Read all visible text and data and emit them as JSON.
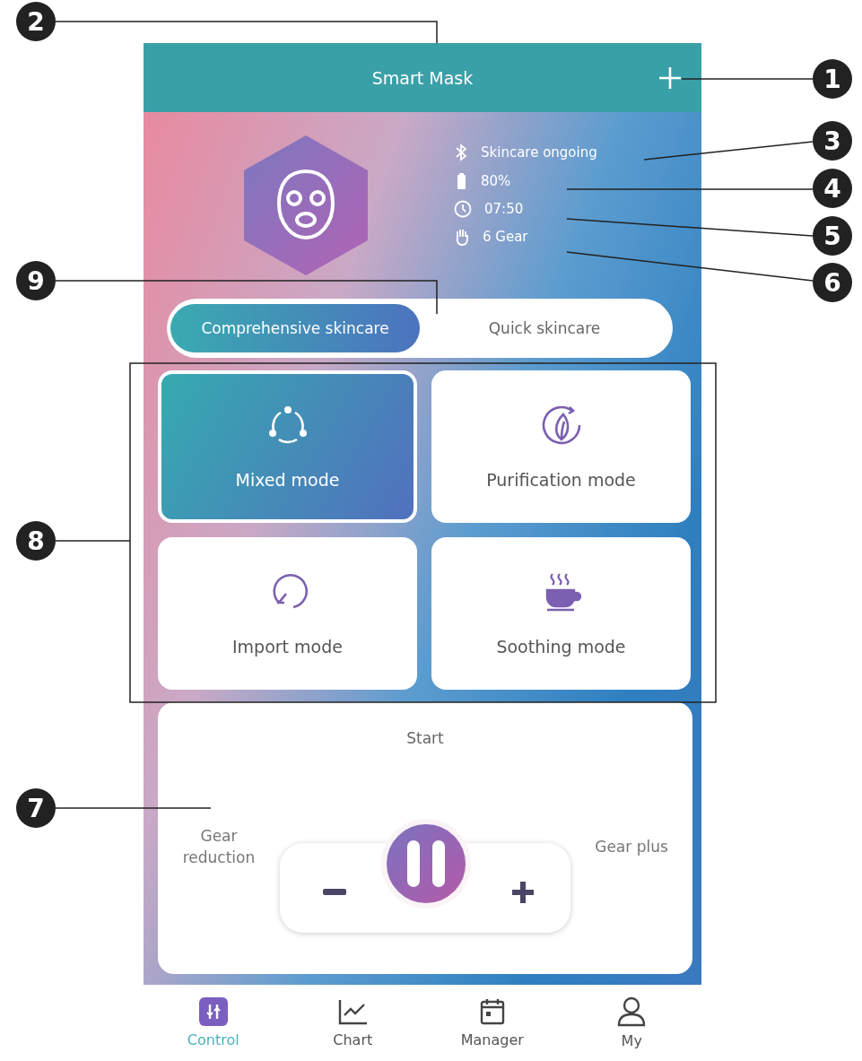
{
  "header": {
    "title": "Smart Mask"
  },
  "status": [
    {
      "kind": "bluetooth",
      "text": "Skincare ongoing"
    },
    {
      "kind": "battery",
      "text": "80%"
    },
    {
      "kind": "clock",
      "text": "07:50"
    },
    {
      "kind": "hand",
      "text": "6 Gear"
    }
  ],
  "tabs": [
    {
      "label": "Comprehensive skincare",
      "selected": true
    },
    {
      "label": "Quick skincare",
      "selected": false
    }
  ],
  "modes": [
    {
      "kind": "mixed",
      "label": "Mixed mode",
      "selected": true
    },
    {
      "kind": "purification",
      "label": "Purification mode",
      "selected": false
    },
    {
      "kind": "import",
      "label": "Import mode",
      "selected": false
    },
    {
      "kind": "soothing",
      "label": "Soothing mode",
      "selected": false
    }
  ],
  "control": {
    "title": "Start",
    "left_label": "Gear reduction",
    "right_label": "Gear plus"
  },
  "nav": [
    {
      "kind": "control",
      "label": "Control",
      "selected": true
    },
    {
      "kind": "chart",
      "label": "Chart",
      "selected": false
    },
    {
      "kind": "manager",
      "label": "Manager",
      "selected": false
    },
    {
      "kind": "my",
      "label": "My",
      "selected": false
    }
  ],
  "callouts": [
    {
      "number": "2"
    },
    {
      "number": "1"
    },
    {
      "number": "3"
    },
    {
      "number": "4"
    },
    {
      "number": "5"
    },
    {
      "number": "9"
    },
    {
      "number": "6"
    },
    {
      "number": "8"
    },
    {
      "number": "7"
    }
  ]
}
